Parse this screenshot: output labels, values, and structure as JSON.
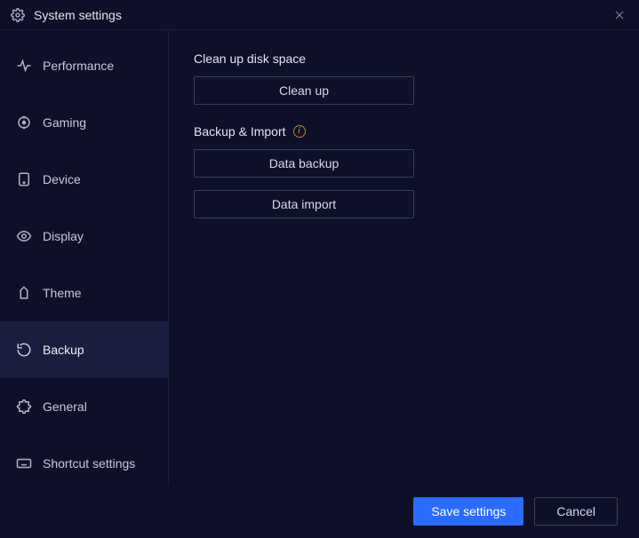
{
  "window": {
    "title": "System settings"
  },
  "sidebar": {
    "items": [
      {
        "label": "Performance"
      },
      {
        "label": "Gaming"
      },
      {
        "label": "Device"
      },
      {
        "label": "Display"
      },
      {
        "label": "Theme"
      },
      {
        "label": "Backup"
      },
      {
        "label": "General"
      },
      {
        "label": "Shortcut settings"
      }
    ],
    "active_index": 5
  },
  "main": {
    "section1": {
      "title": "Clean up disk space",
      "cleanup_button": "Clean up"
    },
    "section2": {
      "title": "Backup & Import",
      "backup_button": "Data backup",
      "import_button": "Data import"
    }
  },
  "footer": {
    "save": "Save settings",
    "cancel": "Cancel"
  }
}
